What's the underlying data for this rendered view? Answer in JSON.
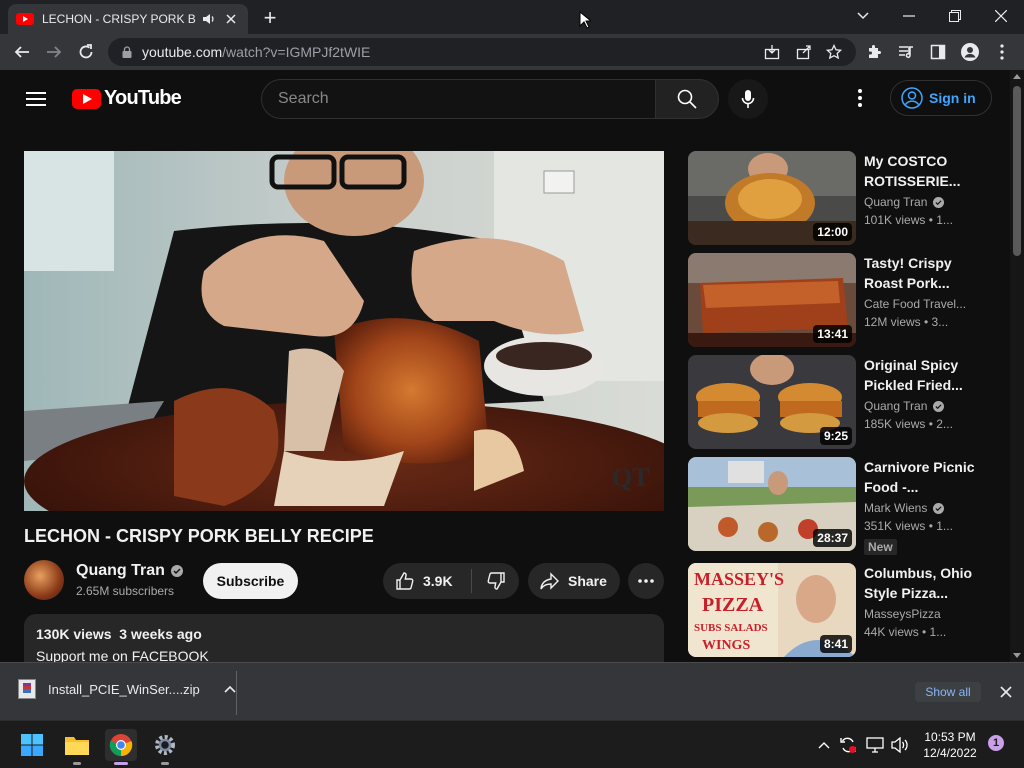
{
  "browser": {
    "tab_title": "LECHON - CRISPY PORK BEL",
    "url_host": "youtube.com",
    "url_path": "/watch?v=IGMPJf2tWIE",
    "new_tab_label": "+"
  },
  "youtube": {
    "logo_text": "YouTube",
    "search_placeholder": "Search",
    "sign_in_label": "Sign in"
  },
  "video": {
    "title": "LECHON - CRISPY PORK BELLY RECIPE",
    "channel": "Quang Tran",
    "subscribers": "2.65M subscribers",
    "subscribe_label": "Subscribe",
    "likes": "3.9K",
    "share_label": "Share",
    "views": "130K views",
    "age": "3 weeks ago",
    "description_line": "Support me on FACEBOOK",
    "watermark": "QT"
  },
  "related": [
    {
      "title": "My COSTCO ROTISSERIE...",
      "channel": "Quang Tran",
      "verified": true,
      "stats": "101K views  •  1...",
      "duration": "12:00",
      "badge": ""
    },
    {
      "title": "Tasty!  Crispy Roast Pork...",
      "channel": "Cate Food Travel...",
      "verified": false,
      "stats": "12M views  •  3...",
      "duration": "13:41",
      "badge": ""
    },
    {
      "title": "Original Spicy Pickled Fried...",
      "channel": "Quang Tran",
      "verified": true,
      "stats": "185K views  •  2...",
      "duration": "9:25",
      "badge": ""
    },
    {
      "title": "Carnivore Picnic Food -...",
      "channel": "Mark Wiens",
      "verified": true,
      "stats": "351K views  •  1...",
      "duration": "28:37",
      "badge": "New"
    },
    {
      "title": "Columbus, Ohio Style Pizza...",
      "channel": "MasseysPizza",
      "verified": false,
      "stats": "44K views  •  1...",
      "duration": "8:41",
      "badge": ""
    }
  ],
  "download": {
    "filename": "Install_PCIE_WinSer....zip",
    "show_all_label": "Show all"
  },
  "taskbar": {
    "time": "10:53 PM",
    "date": "12/4/2022",
    "notification_count": "1"
  },
  "colors": {
    "youtube_red": "#ff0000",
    "link_blue": "#3ea6ff",
    "background": "#0f0f0f"
  }
}
